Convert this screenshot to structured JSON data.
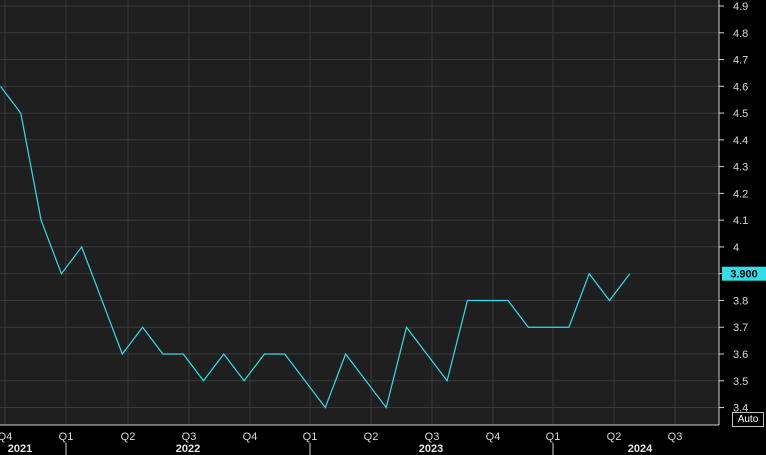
{
  "chart_data": {
    "type": "line",
    "x": [
      "2021 Q3",
      "2021 Q3",
      "2021 Q4",
      "2021 Q4",
      "2021 Q4",
      "2022 Q1",
      "2022 Q1",
      "2022 Q1",
      "2022 Q2",
      "2022 Q2",
      "2022 Q2",
      "2022 Q3",
      "2022 Q3",
      "2022 Q3",
      "2022 Q4",
      "2022 Q4",
      "2022 Q4",
      "2023 Q1",
      "2023 Q1",
      "2023 Q1",
      "2023 Q2",
      "2023 Q2",
      "2023 Q2",
      "2023 Q3",
      "2023 Q3",
      "2023 Q3",
      "2023 Q4",
      "2023 Q4",
      "2023 Q4",
      "2024 Q1",
      "2024 Q1",
      "2024 Q1",
      "2024 Q2"
    ],
    "series": [
      {
        "values": [
          4.6,
          4.5,
          4.1,
          3.9,
          4.0,
          3.8,
          3.6,
          3.7,
          3.6,
          3.6,
          3.5,
          3.6,
          3.5,
          3.6,
          3.6,
          3.5,
          3.4,
          3.6,
          3.5,
          3.4,
          3.7,
          3.6,
          3.5,
          3.8,
          3.8,
          3.8,
          3.7,
          3.7,
          3.7,
          3.9,
          3.8,
          3.9
        ]
      }
    ],
    "ylim": [
      3.35,
      4.92
    ],
    "y_ticks": [
      "4.9",
      "4.8",
      "4.7",
      "4.6",
      "4.5",
      "4.4",
      "4.3",
      "4.2",
      "4.1",
      "4",
      "3.9",
      "3.8",
      "3.7",
      "3.6",
      "3.5",
      "3.4"
    ],
    "x_ticks": [
      "Q4",
      "Q1",
      "Q2",
      "Q3",
      "Q4",
      "Q1",
      "Q2",
      "Q3",
      "Q4",
      "Q1",
      "Q2",
      "Q3"
    ],
    "years": [
      "2021",
      "2022",
      "2023",
      "2024"
    ],
    "last_value_label": "3.900",
    "grid": true,
    "colors": {
      "line": "#2de0e8",
      "background": "#000000",
      "plot": "#1f1f1f",
      "grid": "#3a3a3a",
      "last_value_bg": "#2de0e8"
    }
  },
  "controls": {
    "auto_label": "Auto"
  }
}
